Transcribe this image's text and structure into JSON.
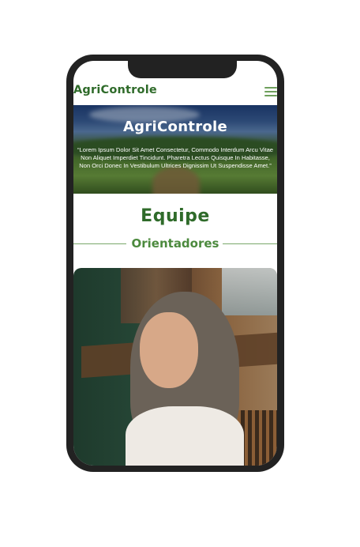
{
  "navbar": {
    "brand": "AgriControle",
    "menu_icon": "hamburger-menu-icon"
  },
  "hero": {
    "title": "AgriControle",
    "text": "“Lorem Ipsum Dolor Sit Amet Consectetur, Commodo Interdum Arcu Vitae Non Aliquet Imperdiet Tincidunt. Pharetra Lectus Quisque In Habitasse, Non Orci Donec In Vestibulum Ultrices Dignissim Ut Suspendisse Amet.”"
  },
  "team": {
    "title": "Equipe",
    "subtitle": "Orientadores"
  },
  "colors": {
    "brand": "#2f6b2a",
    "accent": "#4c8a3e"
  }
}
